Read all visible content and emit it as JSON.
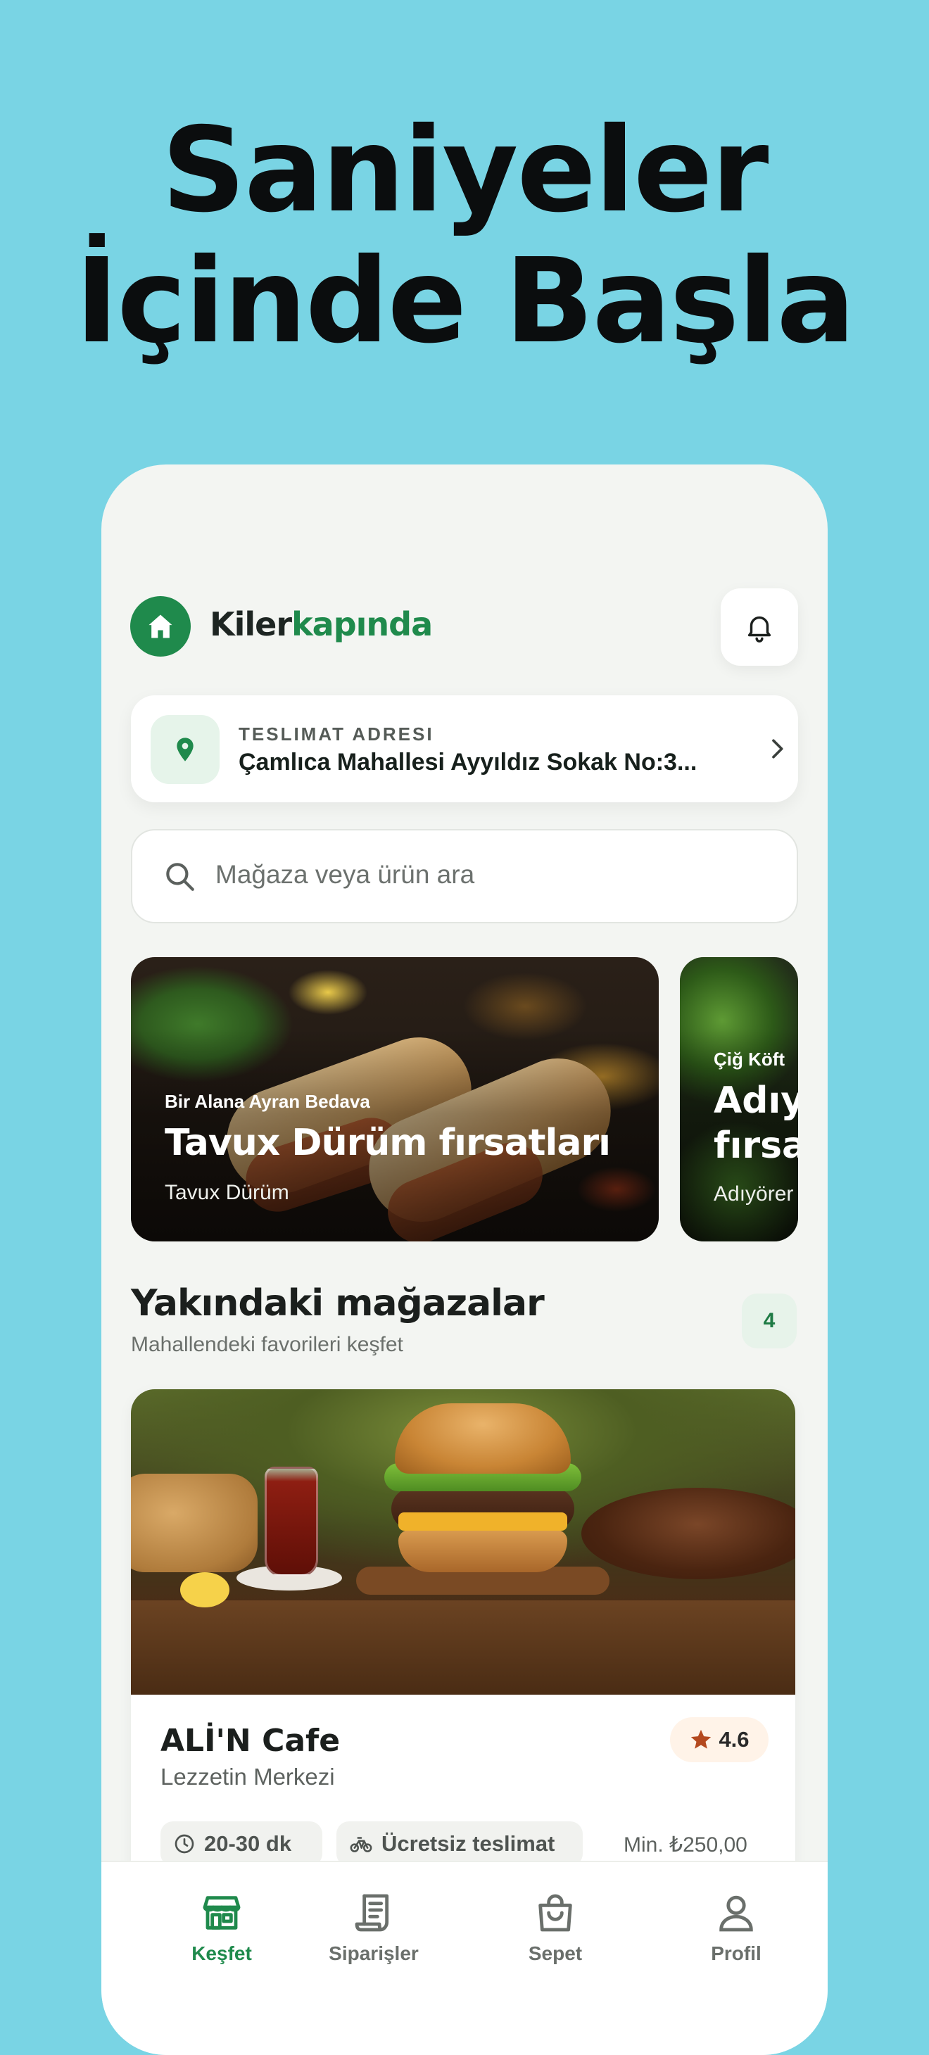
{
  "headline": {
    "line1": "Saniyeler",
    "line2": "İçinde Başla"
  },
  "header": {
    "brand_part1": "Kiler",
    "brand_part2": "kapında"
  },
  "address": {
    "label": "TESLIMAT ADRESI",
    "value": "Çamlıca Mahallesi Ayyıldız Sokak No:3..."
  },
  "search": {
    "placeholder": "Mağaza veya ürün ara"
  },
  "banners": [
    {
      "subtitle": "Bir Alana Ayran Bedava",
      "title": "Tavux Dürüm fırsatları",
      "caption": "Tavux Dürüm"
    },
    {
      "subtitle": "Çiğ Köft",
      "title_line1": "Adıy",
      "title_line2": "fırsa",
      "caption": "Adıyörer"
    }
  ],
  "section": {
    "title": "Yakındaki mağazalar",
    "subtitle": "Mahallendeki favorileri keşfet",
    "count": "4"
  },
  "store": {
    "name": "ALİ'N Cafe",
    "tagline": "Lezzetin Merkezi",
    "rating": "4.6",
    "delivery_time": "20-30 dk",
    "delivery_fee": "Ücretsiz teslimat",
    "min_order": "Min. ₺250,00"
  },
  "tabs": [
    {
      "label": "Keşfet",
      "icon": "storefront-icon",
      "active": true
    },
    {
      "label": "Siparişler",
      "icon": "receipt-icon",
      "active": false
    },
    {
      "label": "Sepet",
      "icon": "shopping-bag-icon",
      "active": false
    },
    {
      "label": "Profil",
      "icon": "user-icon",
      "active": false
    }
  ],
  "colors": {
    "background": "#79d4e4",
    "brand_green": "#1f8a4c",
    "rating_star": "#b4491f",
    "phone_surface": "#f3f5f2"
  }
}
